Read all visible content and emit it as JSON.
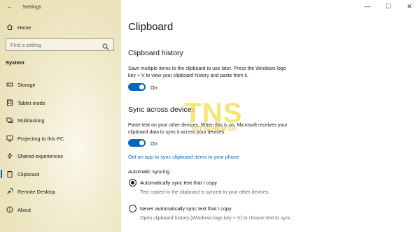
{
  "window": {
    "title": "Settings",
    "minimize": "—",
    "maximize": "☐",
    "close": "✕"
  },
  "sidebar": {
    "home": "Home",
    "search_placeholder": "Find a setting",
    "section": "System",
    "items": [
      {
        "label": "Storage",
        "icon": "storage-icon"
      },
      {
        "label": "Tablet mode",
        "icon": "tablet-mode-icon"
      },
      {
        "label": "Multitasking",
        "icon": "multitasking-icon"
      },
      {
        "label": "Projecting to this PC",
        "icon": "projecting-icon"
      },
      {
        "label": "Shared experiences",
        "icon": "shared-experiences-icon"
      },
      {
        "label": "Clipboard",
        "icon": "clipboard-icon"
      },
      {
        "label": "Remote Desktop",
        "icon": "remote-desktop-icon"
      },
      {
        "label": "About",
        "icon": "about-icon"
      }
    ],
    "active": "Clipboard"
  },
  "main": {
    "title": "Clipboard",
    "history": {
      "heading": "Clipboard history",
      "desc": "Save multiple items to the clipboard to use later. Press the Windows logo key + V to view your clipboard history and paste from it.",
      "toggle_state": "On"
    },
    "sync": {
      "heading": "Sync across devices",
      "desc": "Paste text on your other devices. When this is on, Microsoft receives your clipboard data to sync it across your devices.",
      "toggle_state": "On",
      "link": "Get an app to sync clipboard items to your phone"
    },
    "auto_sync": {
      "heading": "Automatic syncing",
      "options": [
        {
          "label": "Automatically sync text that I copy",
          "desc": "Text copied to the clipboard is synced to your other devices.",
          "checked": true
        },
        {
          "label": "Never automatically sync text that I copy",
          "desc": "Open clipboard history (Windows logo key + V) to choose text to sync.",
          "checked": false
        }
      ]
    }
  },
  "watermark": {
    "brand": "TNS",
    "sub": "TỐT NGHIỆM SỐ"
  },
  "colors": {
    "accent": "#0067c0",
    "watermark_yellow": "#f2e35b"
  }
}
